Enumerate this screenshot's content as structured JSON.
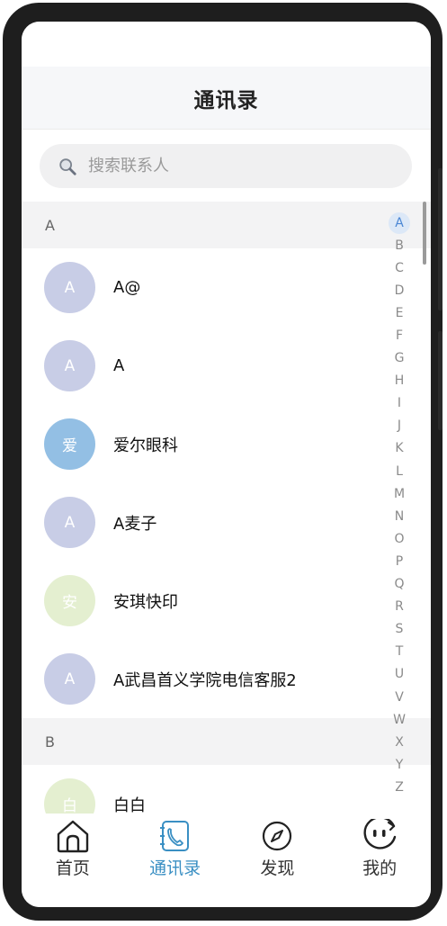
{
  "header": {
    "title": "通讯录"
  },
  "search": {
    "placeholder": "搜索联系人",
    "value": ""
  },
  "sections": [
    {
      "letter": "A",
      "contacts": [
        {
          "avatar_text": "A",
          "name": "A@",
          "avatar_color": "#c8cde6"
        },
        {
          "avatar_text": "A",
          "name": "A",
          "avatar_color": "#c8cde6"
        },
        {
          "avatar_text": "爱",
          "name": "爱尔眼科",
          "avatar_color": "#93bfe4"
        },
        {
          "avatar_text": "A",
          "name": "A麦子",
          "avatar_color": "#c8cde6"
        },
        {
          "avatar_text": "安",
          "name": "安琪快印",
          "avatar_color": "#e4efd0"
        },
        {
          "avatar_text": "A",
          "name": "A武昌首义学院电信客服2",
          "avatar_color": "#c8cde6"
        }
      ]
    },
    {
      "letter": "B",
      "contacts": [
        {
          "avatar_text": "白",
          "name": "白白",
          "avatar_color": "#e4efd0"
        }
      ]
    }
  ],
  "alpha_index": [
    "A",
    "B",
    "C",
    "D",
    "E",
    "F",
    "G",
    "H",
    "I",
    "J",
    "K",
    "L",
    "M",
    "N",
    "O",
    "P",
    "Q",
    "R",
    "S",
    "T",
    "U",
    "V",
    "W",
    "X",
    "Y",
    "Z"
  ],
  "alpha_active": "A",
  "tabs": [
    {
      "label": "首页",
      "icon": "home-icon",
      "active": false
    },
    {
      "label": "通讯录",
      "icon": "contacts-icon",
      "active": true
    },
    {
      "label": "发现",
      "icon": "compass-icon",
      "active": false
    },
    {
      "label": "我的",
      "icon": "profile-face-icon",
      "active": false
    }
  ],
  "colors": {
    "accent": "#3a8fc3",
    "header_bg": "#f6f7f9",
    "section_bg": "#f3f3f4"
  }
}
